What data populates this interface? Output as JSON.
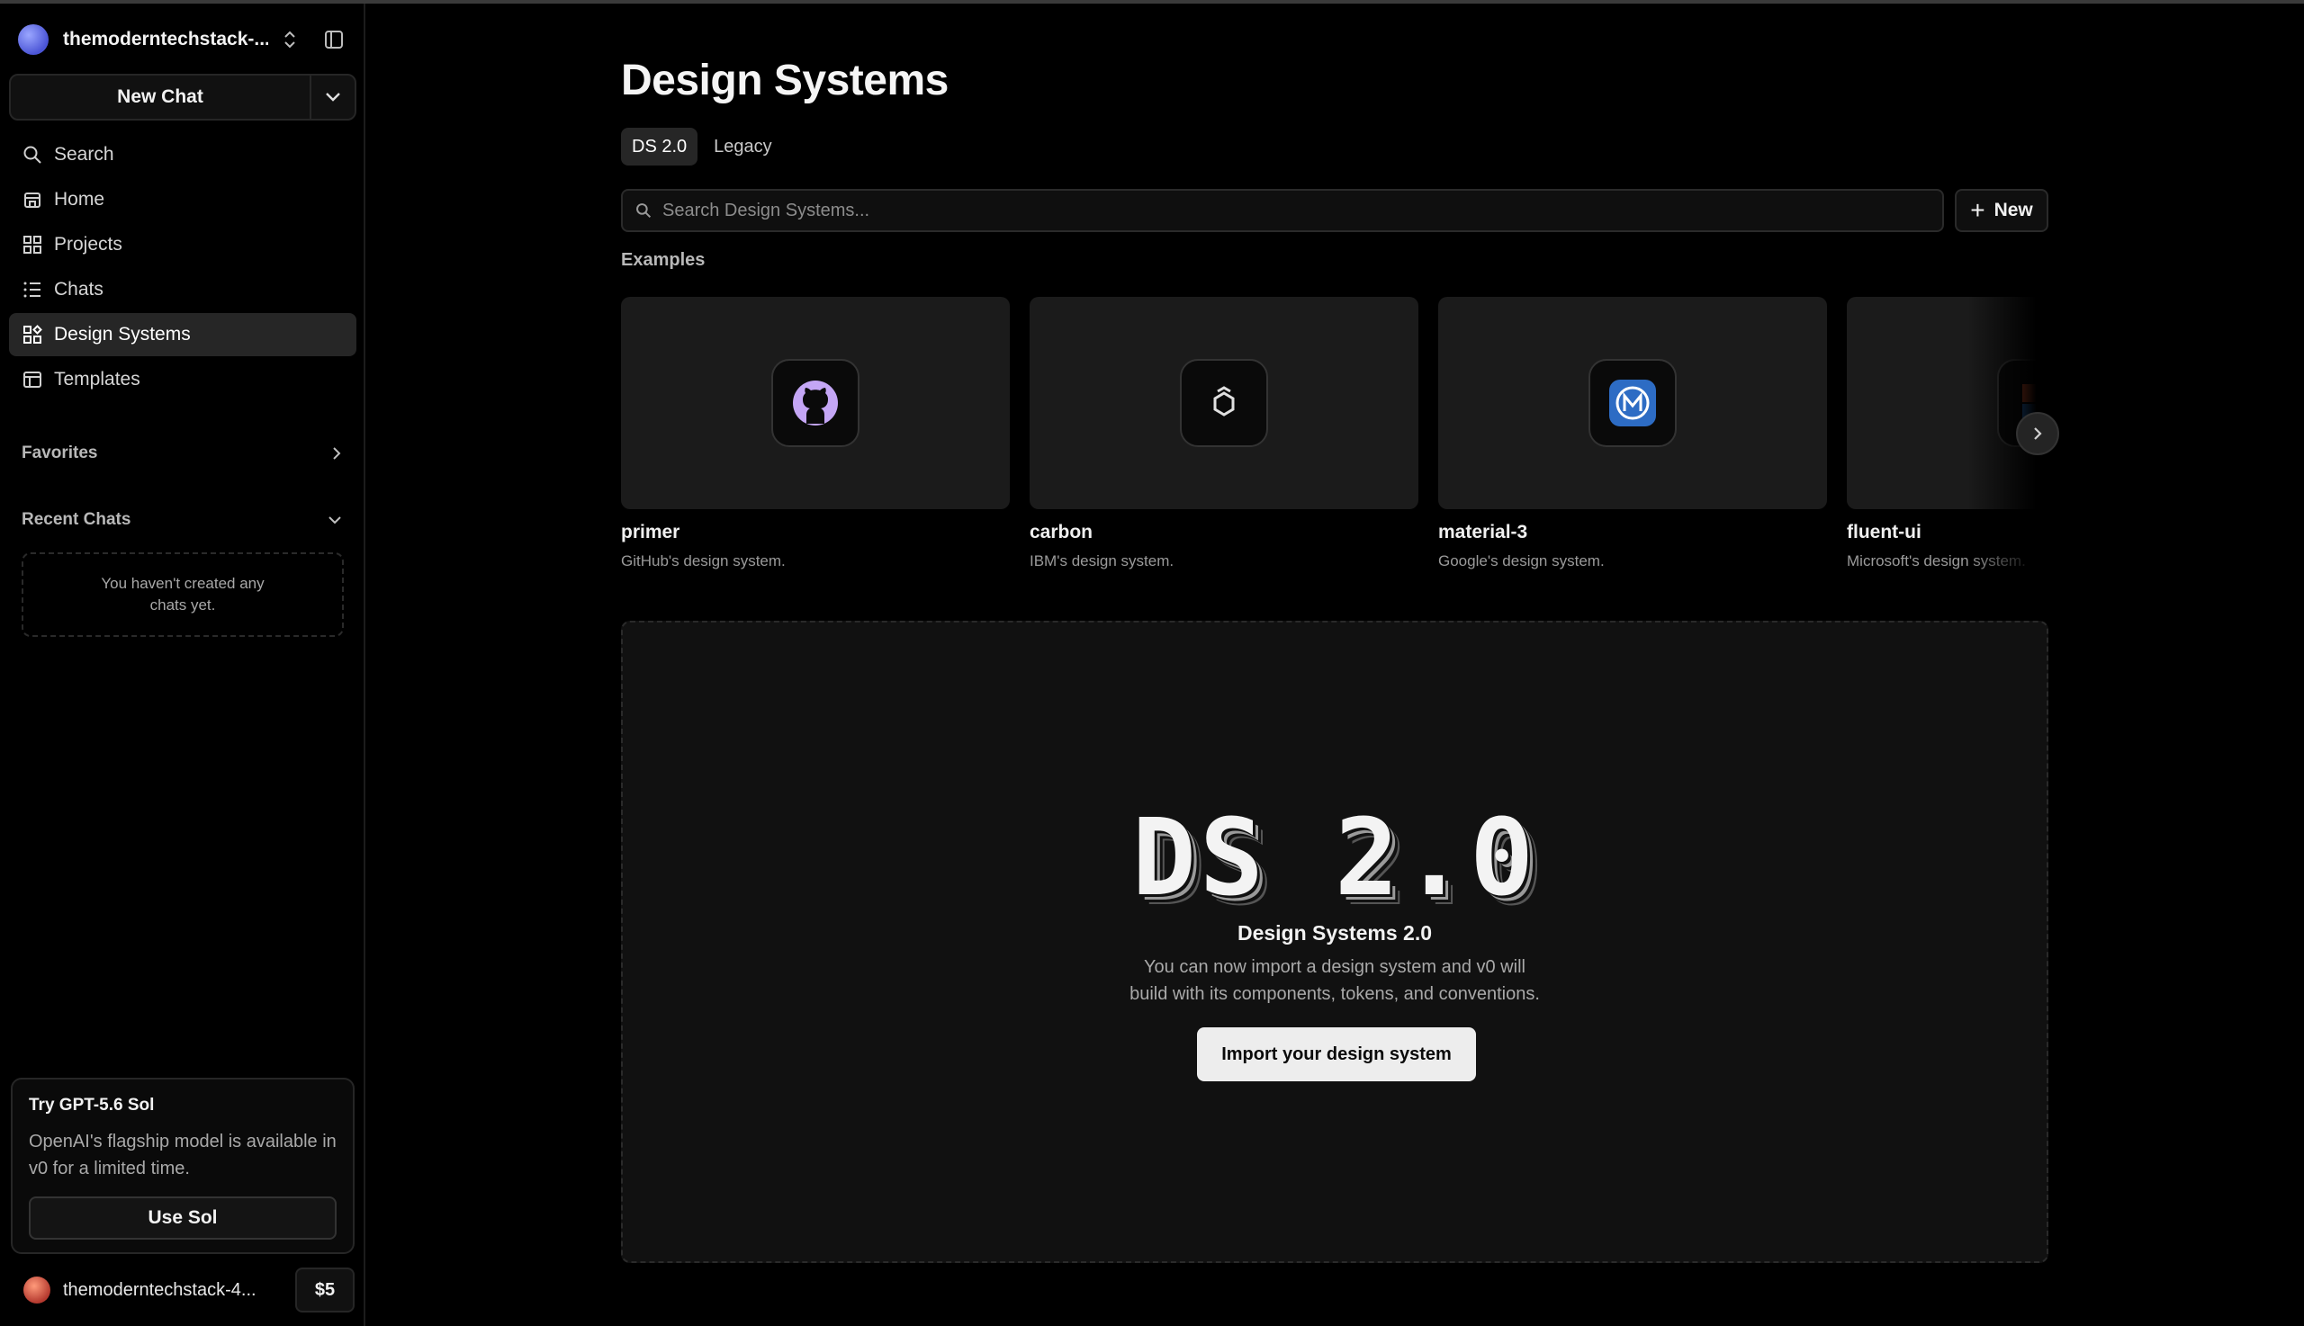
{
  "team": {
    "name": "themoderntechstack-...",
    "avatar": "team-avatar-gradient"
  },
  "new_chat": {
    "label": "New Chat"
  },
  "nav": {
    "items": [
      {
        "label": "Search",
        "icon": "search-icon"
      },
      {
        "label": "Home",
        "icon": "home-icon"
      },
      {
        "label": "Projects",
        "icon": "grid-icon"
      },
      {
        "label": "Chats",
        "icon": "list-icon"
      },
      {
        "label": "Design Systems",
        "icon": "design-systems-icon",
        "active": true
      },
      {
        "label": "Templates",
        "icon": "template-icon"
      }
    ]
  },
  "favorites": {
    "label": "Favorites"
  },
  "recent_chats": {
    "label": "Recent Chats",
    "empty_text": "You haven't created any chats yet."
  },
  "promo": {
    "title": "Try GPT-5.6 Sol",
    "text": "OpenAI's flagship model is available in v0 for a limited time.",
    "button": "Use Sol"
  },
  "account": {
    "name": "themoderntechstack-4...",
    "credits": "$5"
  },
  "main": {
    "title": "Design Systems",
    "tabs": [
      {
        "label": "DS 2.0",
        "active": true
      },
      {
        "label": "Legacy",
        "active": false
      }
    ],
    "search_placeholder": "Search Design Systems...",
    "new_button": "New",
    "examples_label": "Examples",
    "examples": [
      {
        "name": "primer",
        "desc": "GitHub's design system.",
        "icon": "github-icon"
      },
      {
        "name": "carbon",
        "desc": "IBM's design system.",
        "icon": "carbon-hexagon-icon"
      },
      {
        "name": "material-3",
        "desc": "Google's design system.",
        "icon": "material-icon"
      },
      {
        "name": "fluent-ui",
        "desc": "Microsoft's design system.",
        "icon": "fluent-icon"
      }
    ]
  },
  "hero": {
    "art_text": "DS 2.0",
    "title": "Design Systems 2.0",
    "text_line1": "You can now import a design system and v0 will",
    "text_line2": "build with its components, tokens, and conventions.",
    "button": "Import your design system"
  },
  "colors": {
    "background": "#000000",
    "surface": "#1b1b1b",
    "active": "#262626",
    "primary_button": "#ededed"
  }
}
